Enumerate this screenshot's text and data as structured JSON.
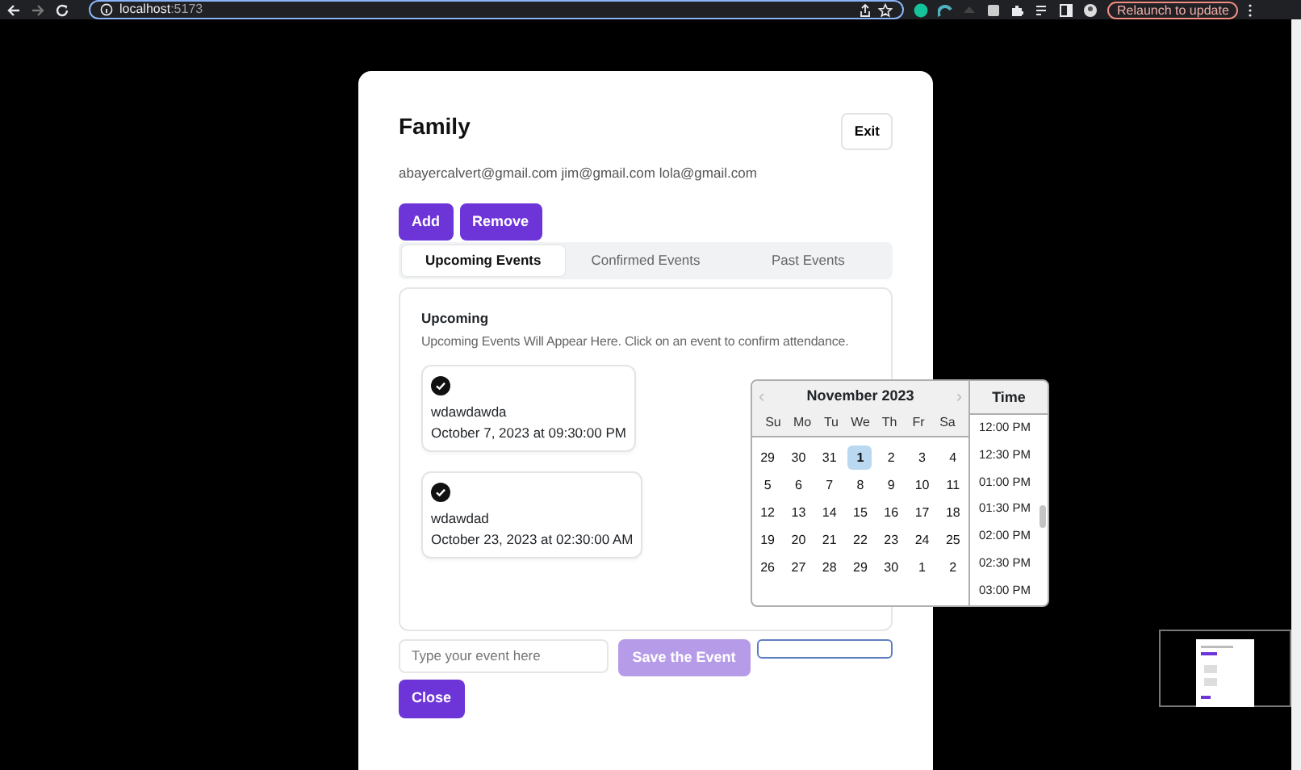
{
  "browser": {
    "url_host": "localhost",
    "url_port": ":5173",
    "update_button": "Relaunch to update"
  },
  "group": {
    "title": "Family",
    "members": "abayercalvert@gmail.com jim@gmail.com lola@gmail.com",
    "exit_button": "Exit"
  },
  "actions": [
    "Add",
    "Remove"
  ],
  "tabs": [
    {
      "label": "Upcoming Events",
      "selected": true
    },
    {
      "label": "Confirmed Events",
      "selected": false
    },
    {
      "label": "Past Events",
      "selected": false
    }
  ],
  "panel": {
    "heading": "Upcoming",
    "description": "Upcoming Events Will Appear Here. Click on an event to confirm attendance."
  },
  "events": [
    {
      "name": "wdawdawda",
      "when": "October 7, 2023 at 09:30:00 PM",
      "confirmed": true
    },
    {
      "name": "wdawdad",
      "when": "October 23, 2023 at 02:30:00 AM",
      "confirmed": true
    }
  ],
  "form": {
    "placeholder": "Type your event here",
    "save_button": "Save the Event",
    "save_disabled": true,
    "close_button": "Close"
  },
  "datepicker": {
    "prev": "‹",
    "next": "›",
    "month": "November 2023",
    "weekdays": [
      "Su",
      "Mo",
      "Tu",
      "We",
      "Th",
      "Fr",
      "Sa"
    ],
    "weeks": [
      [
        {
          "label": "29",
          "selected": false
        },
        {
          "label": "30",
          "selected": false
        },
        {
          "label": "31",
          "selected": false
        },
        {
          "label": "1",
          "selected": true
        },
        {
          "label": "2",
          "selected": false
        },
        {
          "label": "3",
          "selected": false
        },
        {
          "label": "4",
          "selected": false
        }
      ],
      [
        {
          "label": "5",
          "selected": false
        },
        {
          "label": "6",
          "selected": false
        },
        {
          "label": "7",
          "selected": false
        },
        {
          "label": "8",
          "selected": false
        },
        {
          "label": "9",
          "selected": false
        },
        {
          "label": "10",
          "selected": false
        },
        {
          "label": "11",
          "selected": false
        }
      ],
      [
        {
          "label": "12",
          "selected": false
        },
        {
          "label": "13",
          "selected": false
        },
        {
          "label": "14",
          "selected": false
        },
        {
          "label": "15",
          "selected": false
        },
        {
          "label": "16",
          "selected": false
        },
        {
          "label": "17",
          "selected": false
        },
        {
          "label": "18",
          "selected": false
        }
      ],
      [
        {
          "label": "19",
          "selected": false
        },
        {
          "label": "20",
          "selected": false
        },
        {
          "label": "21",
          "selected": false
        },
        {
          "label": "22",
          "selected": false
        },
        {
          "label": "23",
          "selected": false
        },
        {
          "label": "24",
          "selected": false
        },
        {
          "label": "25",
          "selected": false
        }
      ],
      [
        {
          "label": "26",
          "selected": false
        },
        {
          "label": "27",
          "selected": false
        },
        {
          "label": "28",
          "selected": false
        },
        {
          "label": "29",
          "selected": false
        },
        {
          "label": "30",
          "selected": false
        },
        {
          "label": "1",
          "selected": false
        },
        {
          "label": "2",
          "selected": false
        }
      ]
    ],
    "time_heading": "Time",
    "times": [
      "12:00 PM",
      "12:30 PM",
      "01:00 PM",
      "01:30 PM",
      "02:00 PM",
      "02:30 PM",
      "03:00 PM"
    ]
  }
}
